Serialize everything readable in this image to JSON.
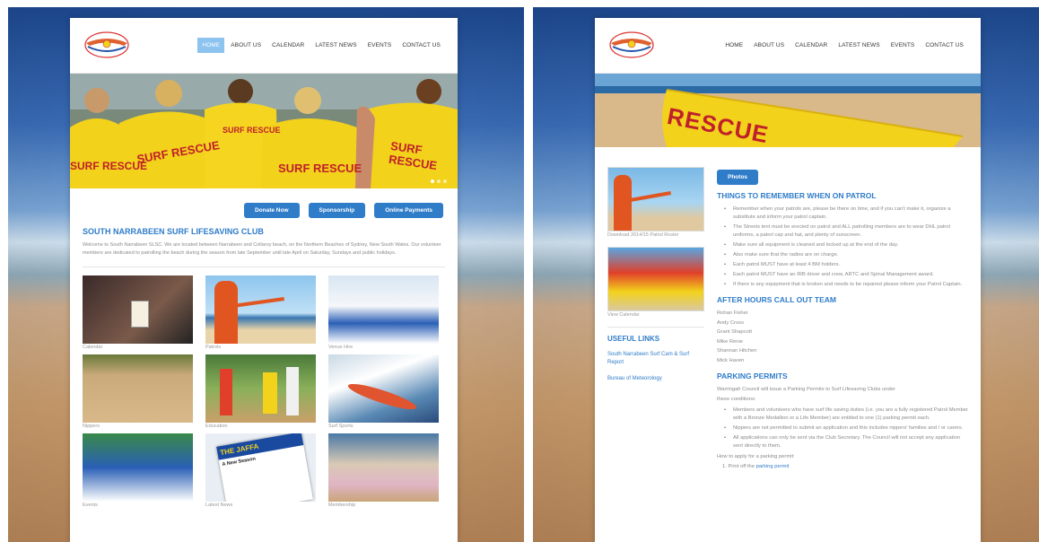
{
  "nav": [
    "HOME",
    "ABOUT US",
    "CALENDAR",
    "LATEST NEWS",
    "EVENTS",
    "CONTACT US"
  ],
  "home": {
    "hero_text": "SURF RESCUE",
    "buttons": [
      "Donate Now",
      "Sponsorship",
      "Online Payments"
    ],
    "title": "SOUTH NARRABEEN SURF LIFESAVING CLUB",
    "intro": "Welcome to South Narrabeen SLSC.  We are located between Narrabeen and Collaroy beach, on the Northern Beaches of Sydney, New South Wales.  Our volunteer members are dedicated to patrolling the beach during the season from late September until late April on Saturday, Sundays and public holidays.",
    "tiles": [
      "Calendar",
      "Patrols",
      "Venue Hire",
      "Nippers",
      "Education",
      "Surf Sports",
      "Events",
      "Latest News",
      "Membership"
    ],
    "news_head": "THE JAFFA",
    "news_sub": "A New Season"
  },
  "patrol": {
    "board_text": "RESCUE",
    "side_captions": [
      "Download 2014/15 Patrol Roster",
      "View Calendar"
    ],
    "useful_links_title": "USEFUL LINKS",
    "useful_links": [
      "South Narrabeen Surf Cam & Surf Report",
      "Bureau of Meteorology"
    ],
    "photos_button": "Photos",
    "remember_title": "THINGS TO REMEMBER WHEN ON PATROL",
    "remember_items": [
      "Remember when your patrols are, please be there on time, and if you can't make it, organize a substitute and inform your patrol captain.",
      "The Streets tent must be erected on patrol and ALL patrolling members are to wear DHL patrol uniforms, a patrol cap and hat, and plenty of sunscreen.",
      "Make sure all equipment is cleaned and locked up at the end of the day.",
      "Also make sure that the radios are on charge.",
      "Each patrol MUST have at least 4 BM holders.",
      "Each patrol MUST have an IRB driver and crew, ARTC and Spinal Management award.",
      "If there is any equipment that is broken and needs to be repaired please inform your Patrol Captain."
    ],
    "after_hours_title": "AFTER HOURS CALL OUT TEAM",
    "after_hours": [
      "Rohan Fisher",
      "Andy Cross",
      "Grant Shapcott",
      "Mike Renie",
      "Shannan Hitchen",
      "Mick Haven"
    ],
    "permits_title": "PARKING PERMITS",
    "permits_intro": "Warringah Council will issue a Parking Permits to Surf Lifesaving Clubs under these conditions:",
    "permit_items": [
      "Members and volunteers who have surf life saving duties (i.e. you are a fully registered Patrol Member with a Bronze Medallion or a Life Member) are entitled to one (1) parking permit each.",
      "Nippers are not permitted to submit an application and this includes nippers' families and / or carers.",
      "All applications can only be sent via the Club Secretary. The Council will not accept any application sent directly to them."
    ],
    "how_to": "How to apply for a parking permit:",
    "step1_prefix": "1.  Print off the ",
    "step1_link": "parking permit"
  },
  "colors": {
    "accent": "#2f7cc9",
    "shirt": "#f2d21b",
    "nav_active": "#8cc3ef"
  }
}
